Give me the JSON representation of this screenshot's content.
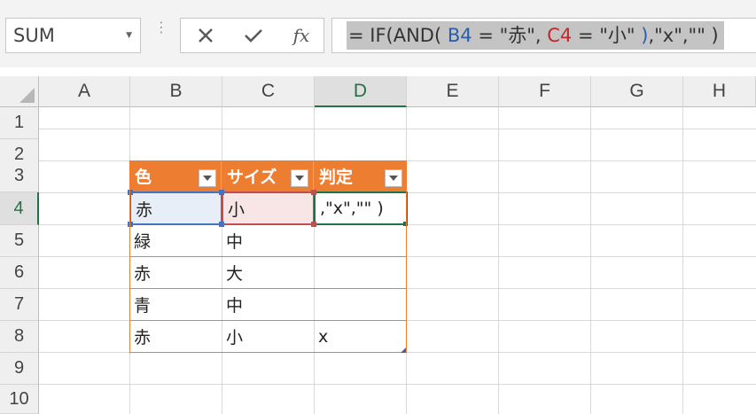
{
  "name_box": {
    "value": "SUM",
    "dropdown_icon": "chevron-down-icon"
  },
  "formula_bar": {
    "cancel_icon": "close-icon",
    "enter_icon": "checkmark-icon",
    "function_icon": "fx-icon",
    "function_label": "fx",
    "formula_parts": [
      "= IF(AND( ",
      "B4",
      " = \"赤\", ",
      "C4",
      " = \"小\" ",
      ")",
      ",\"x\",\"\" )"
    ]
  },
  "columns": [
    "A",
    "B",
    "C",
    "D",
    "E",
    "F",
    "G",
    "H"
  ],
  "rows": [
    "1",
    "2",
    "3",
    "4",
    "5",
    "6",
    "7",
    "8",
    "9",
    "10"
  ],
  "active_cell": {
    "column": "D",
    "row": "4"
  },
  "table": {
    "headers": [
      "色",
      "サイズ",
      "判定"
    ],
    "rows": [
      [
        "赤",
        "小",
        ",\"x\",\"\" )"
      ],
      [
        "緑",
        "中",
        ""
      ],
      [
        "赤",
        "大",
        ""
      ],
      [
        "青",
        "中",
        ""
      ],
      [
        "赤",
        "小",
        "x"
      ]
    ],
    "header_color": "#ed7d31"
  },
  "colors": {
    "accent_green": "#217346",
    "ref_blue": "#2b5ea7",
    "ref_red": "#c0282f"
  }
}
